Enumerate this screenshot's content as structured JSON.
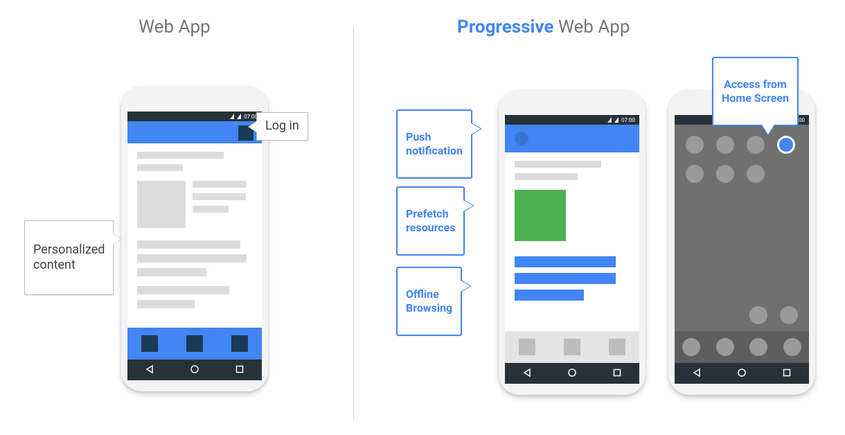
{
  "titles": {
    "left": "Web App",
    "right_highlight": "Progressive",
    "right_rest": " Web App"
  },
  "status": {
    "time": "07:00"
  },
  "callouts": {
    "login": "Log in",
    "personalized": "Personalized\ncontent",
    "push": "Push\nnotification",
    "prefetch": "Prefetch\nresources",
    "offline": "Offline\nBrowsing",
    "homescreen": "Access from\nHome Screen"
  }
}
